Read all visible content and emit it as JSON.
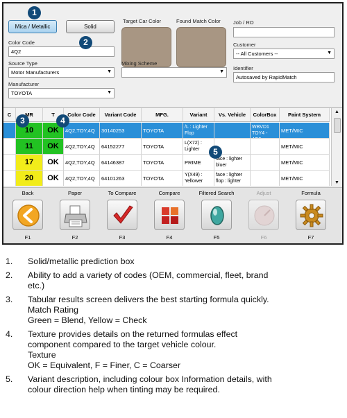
{
  "top": {
    "mica_metallic_label": "Mica / Metallic",
    "solid_label": "Solid",
    "target_color_label": "Target Car Color",
    "found_match_label": "Found Match Color",
    "job_ro_label": "Job / RO",
    "job_ro_value": "",
    "color_code_label": "Color Code",
    "color_code_value": "4Q2",
    "customer_label": "Customer",
    "customer_value": "-- All Customers --",
    "source_type_label": "Source Type",
    "source_type_value": "Motor Manufacturers",
    "mixing_scheme_label": "Mixing Scheme",
    "mixing_scheme_value": "",
    "identifier_label": "Identifier",
    "identifier_value": "Autosaved by RapidMatch",
    "manufacturer_label": "Manufacturer",
    "manufacturer_value": "TOYOTA",
    "swatch_color": "#a89683"
  },
  "badges": [
    "1",
    "2",
    "3",
    "4",
    "5"
  ],
  "table": {
    "headers": [
      "C",
      "MR",
      "T",
      "Color Code",
      "Variant Code",
      "MFG.",
      "Variant",
      "Vs. Vehicle",
      "ColorBox",
      "Paint System"
    ],
    "rows": [
      {
        "mr": "10",
        "mr_color": "#22c222",
        "t": "OK",
        "t_color": "#22c222",
        "code": "4Q2,TOY,4Q",
        "variant_code": "30140253",
        "mfg": "TOYOTA",
        "variant": "/L : Lighter Flop",
        "vs": "",
        "colorbox": "WBVD1 TOY4 - 4Q2",
        "system": "MET/MIC"
      },
      {
        "mr": "11",
        "mr_color": "#22c222",
        "t": "OK",
        "t_color": "#22c222",
        "code": "4Q2,TOY,4Q",
        "variant_code": "64152277",
        "mfg": "TOYOTA",
        "variant": "L(X72) : Lighter",
        "vs": "",
        "colorbox": "",
        "system": "MET/MIC"
      },
      {
        "mr": "17",
        "mr_color": "#f2ec1a",
        "t": "OK",
        "t_color": "#ffffff",
        "code": "4Q2,TOY,4Q",
        "variant_code": "64146387",
        "mfg": "TOYOTA",
        "variant": "PRIME",
        "vs": "face : lighter bluer",
        "colorbox": "",
        "system": "MET/MIC"
      },
      {
        "mr": "20",
        "mr_color": "#f2ec1a",
        "t": "OK",
        "t_color": "#ffffff",
        "code": "4Q2,TOY,4Q",
        "variant_code": "64101263",
        "mfg": "TOYOTA",
        "variant": "Y(X49) : Yellower",
        "vs": "face : lighter flop : lighter",
        "colorbox": "",
        "system": "MET/MIC"
      }
    ]
  },
  "toolbar": [
    {
      "label": "Back",
      "key": "F1",
      "icon": "back-arrow-icon"
    },
    {
      "label": "Paper",
      "key": "F2",
      "icon": "printer-icon"
    },
    {
      "label": "To Compare",
      "key": "F3",
      "icon": "checkmark-icon"
    },
    {
      "label": "Compare",
      "key": "F4",
      "icon": "compare-grid-icon"
    },
    {
      "label": "Filtered Search",
      "key": "F5",
      "icon": "gem-icon"
    },
    {
      "label": "Adjust",
      "key": "F6",
      "icon": "adjust-icon"
    },
    {
      "label": "Formula",
      "key": "F7",
      "icon": "gear-icon"
    }
  ],
  "notes": [
    {
      "num": "1.",
      "lines": [
        "Solid/metallic prediction box"
      ]
    },
    {
      "num": "2.",
      "lines": [
        "Ability to add a variety of codes (OEM, commercial, fleet, brand",
        "etc.)"
      ]
    },
    {
      "num": "3.",
      "lines": [
        "Tabular results screen delivers the best starting formula quickly.",
        "Match Rating",
        "Green = Blend, Yellow = Check"
      ]
    },
    {
      "num": "4.",
      "lines": [
        "Texture provides details on the returned formulas effect",
        "component compared to the target vehicle colour.",
        "Texture",
        "OK = Equivalent, F = Finer, C = Coarser"
      ]
    },
    {
      "num": "5.",
      "lines": [
        "Variant description, including colour box Information details, with",
        "colour direction help when tinting may be required."
      ]
    }
  ]
}
